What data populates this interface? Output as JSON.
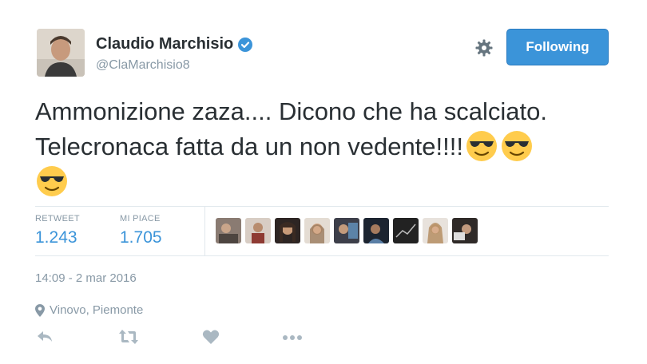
{
  "user": {
    "name": "Claudio Marchisio",
    "handle": "@ClaMarchisio8"
  },
  "follow_button": {
    "label": "Following"
  },
  "tweet": {
    "line1": "Ammonizione zaza.... Dicono che ha scalciato.",
    "line2": "Telecronaca fatta da un non vedente!!!!",
    "emojis": [
      "smiling-face-with-sunglasses",
      "smiling-face-with-sunglasses",
      "smiling-face-with-sunglasses"
    ]
  },
  "stats": {
    "retweet_label": "RETWEET",
    "retweet_count": "1.243",
    "likes_label": "MI PIACE",
    "likes_count": "1.705",
    "liker_avatar_count": 9
  },
  "meta": {
    "timestamp": "14:09 - 2 mar 2016",
    "location": "Vinovo, Piemonte"
  },
  "colors": {
    "accent": "#3b94d9",
    "muted": "#8899a6",
    "text": "#292f33",
    "divider": "#e1e8ed"
  }
}
